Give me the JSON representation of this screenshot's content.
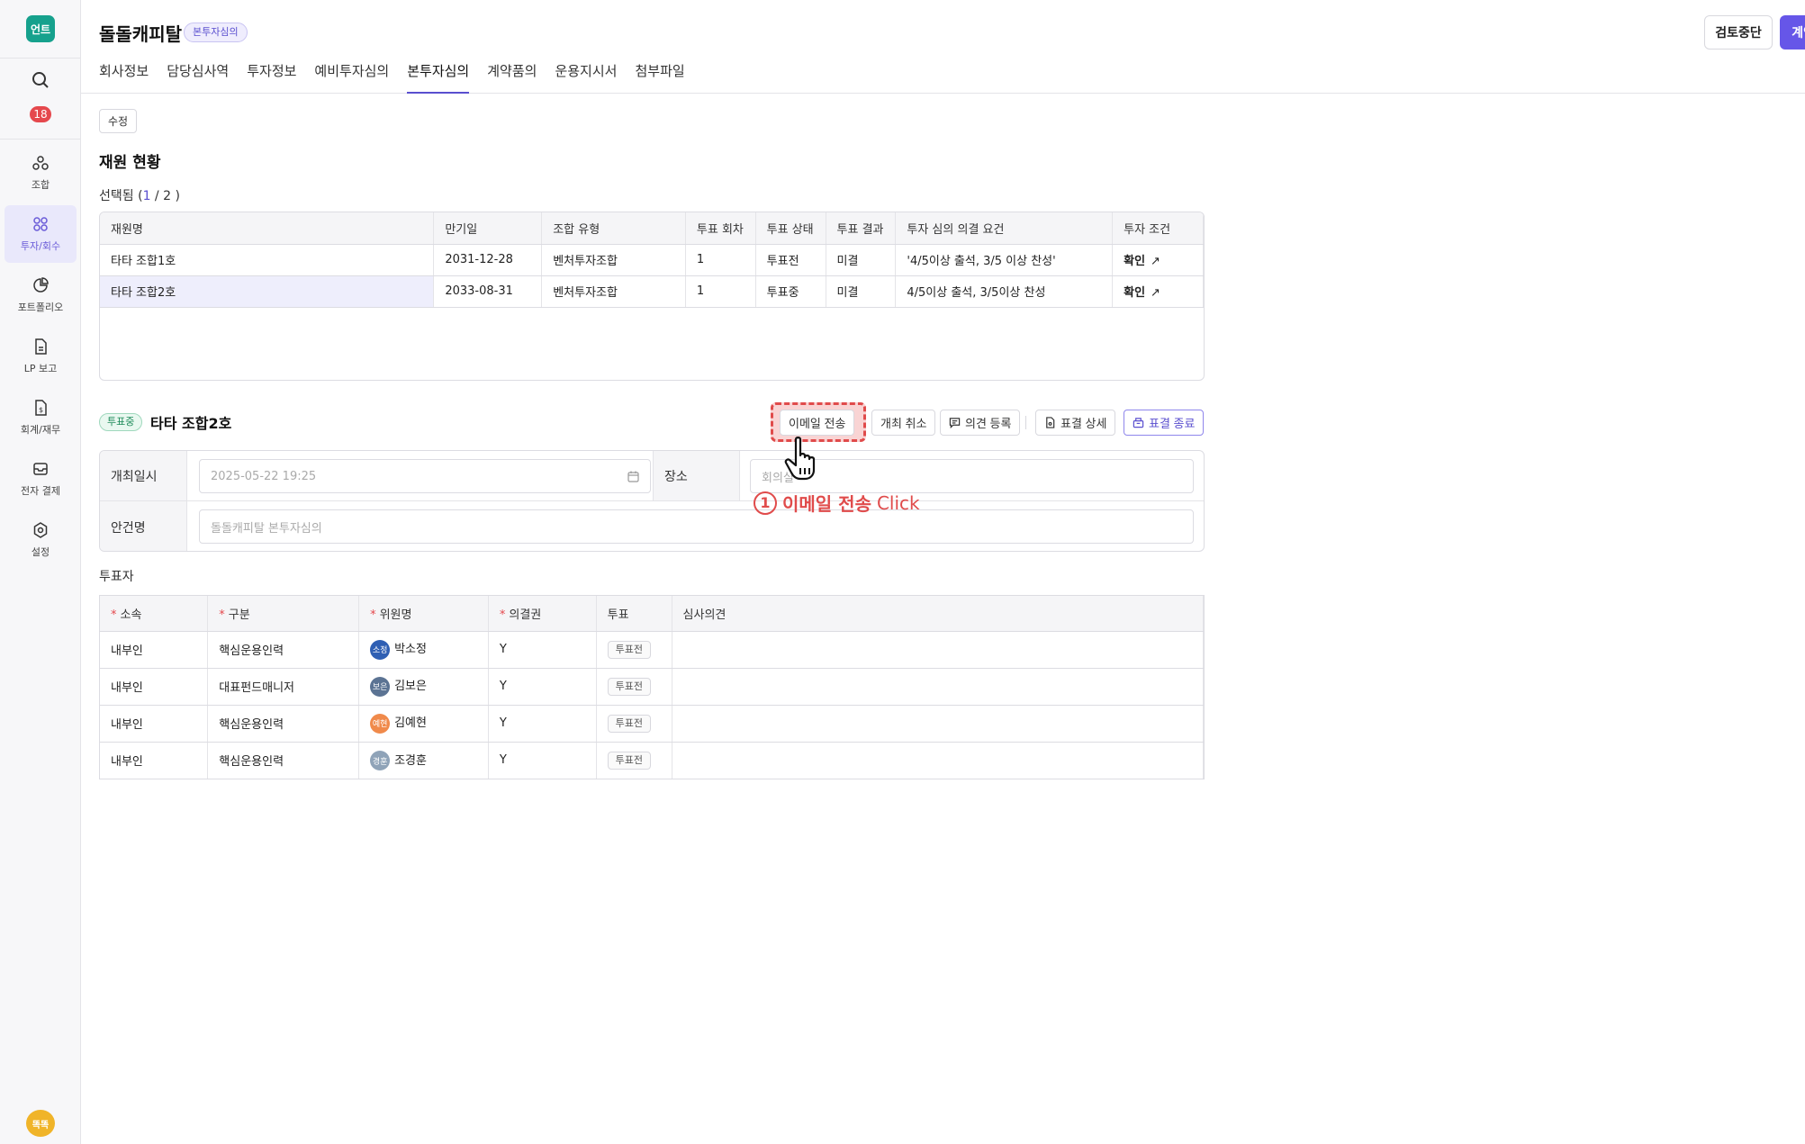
{
  "sidebar": {
    "logo_text": "언트",
    "badge_count": "18",
    "items": [
      {
        "label": "조합",
        "icon": "fund-icon"
      },
      {
        "label": "투자/회수",
        "icon": "investment-icon",
        "active": true
      },
      {
        "label": "포트폴리오",
        "icon": "portfolio-icon"
      },
      {
        "label": "LP 보고",
        "icon": "report-icon"
      },
      {
        "label": "회계/재무",
        "icon": "accounting-icon"
      },
      {
        "label": "전자 결제",
        "icon": "mail-icon"
      },
      {
        "label": "설정",
        "icon": "gear-icon"
      }
    ],
    "user_avatar": "똑똑"
  },
  "header": {
    "title": "돌돌캐피탈",
    "status_badge": "본투자심의",
    "tabs": [
      {
        "label": "회사정보"
      },
      {
        "label": "담당심사역"
      },
      {
        "label": "투자정보"
      },
      {
        "label": "예비투자심의"
      },
      {
        "label": "본투자심의",
        "active": true
      },
      {
        "label": "계약품의"
      },
      {
        "label": "운용지시서"
      },
      {
        "label": "첨부파일"
      }
    ],
    "stop_button": "검토중단",
    "contract_button": "계약품의"
  },
  "content": {
    "edit_button": "수정",
    "section_title": "재원 현황",
    "selected_prefix": "선택됨 (",
    "selected_current": "1",
    "selected_sep": " / ",
    "selected_total": "2",
    "selected_suffix": " )",
    "fund_table": {
      "headers": [
        "재원명",
        "만기일",
        "조합 유형",
        "투표 회차",
        "투표 상태",
        "투표 결과",
        "투자 심의 의결 요건",
        "투자 조건"
      ],
      "rows": [
        {
          "name": "타타 조합1호",
          "maturity": "2031-12-28",
          "type": "벤처투자조합",
          "round": "1",
          "status": "투표전",
          "result": "미결",
          "requirement": "'4/5이상 출석, 3/5 이상 찬성'",
          "condition": "확인"
        },
        {
          "name": "타타 조합2호",
          "maturity": "2033-08-31",
          "type": "벤처투자조합",
          "round": "1",
          "status": "투표중",
          "result": "미결",
          "requirement": "4/5이상 출석, 3/5이상 찬성",
          "condition": "확인"
        }
      ]
    },
    "vote": {
      "badge": "투표중",
      "title": "타타 조합2호",
      "buttons": {
        "email": "이메일 전송",
        "cancel": "개최 취소",
        "opinion": "의견 등록",
        "detail": "표결 상세",
        "end": "표결 종료"
      }
    },
    "meeting": {
      "date_label": "개최일시",
      "date_value": "2025-05-22 19:25",
      "place_label": "장소",
      "place_placeholder": "회의실",
      "agenda_label": "안건명",
      "agenda_value": "돌돌캐피탈 본투자심의"
    },
    "annotation": {
      "number": "1",
      "text": "이메일 전송",
      "action": "Click"
    },
    "voters_label": "투표자",
    "voter_table": {
      "headers": [
        "소속",
        "구분",
        "위원명",
        "의결권",
        "투표",
        "심사의견"
      ],
      "rows": [
        {
          "org": "내부인",
          "role": "핵심운용인력",
          "avatar": "소정",
          "avatar_color": "#2f5fb3",
          "name": "박소정",
          "right": "Y",
          "vote": "투표전",
          "opinion": ""
        },
        {
          "org": "내부인",
          "role": "대표펀드매니저",
          "avatar": "보은",
          "avatar_color": "#5b7393",
          "name": "김보은",
          "right": "Y",
          "vote": "투표전",
          "opinion": ""
        },
        {
          "org": "내부인",
          "role": "핵심운용인력",
          "avatar": "예현",
          "avatar_color": "#f08a4b",
          "name": "김예현",
          "right": "Y",
          "vote": "투표전",
          "opinion": ""
        },
        {
          "org": "내부인",
          "role": "핵심운용인력",
          "avatar": "경훈",
          "avatar_color": "#8fa3b8",
          "name": "조경훈",
          "right": "Y",
          "vote": "투표전",
          "opinion": ""
        }
      ]
    }
  }
}
